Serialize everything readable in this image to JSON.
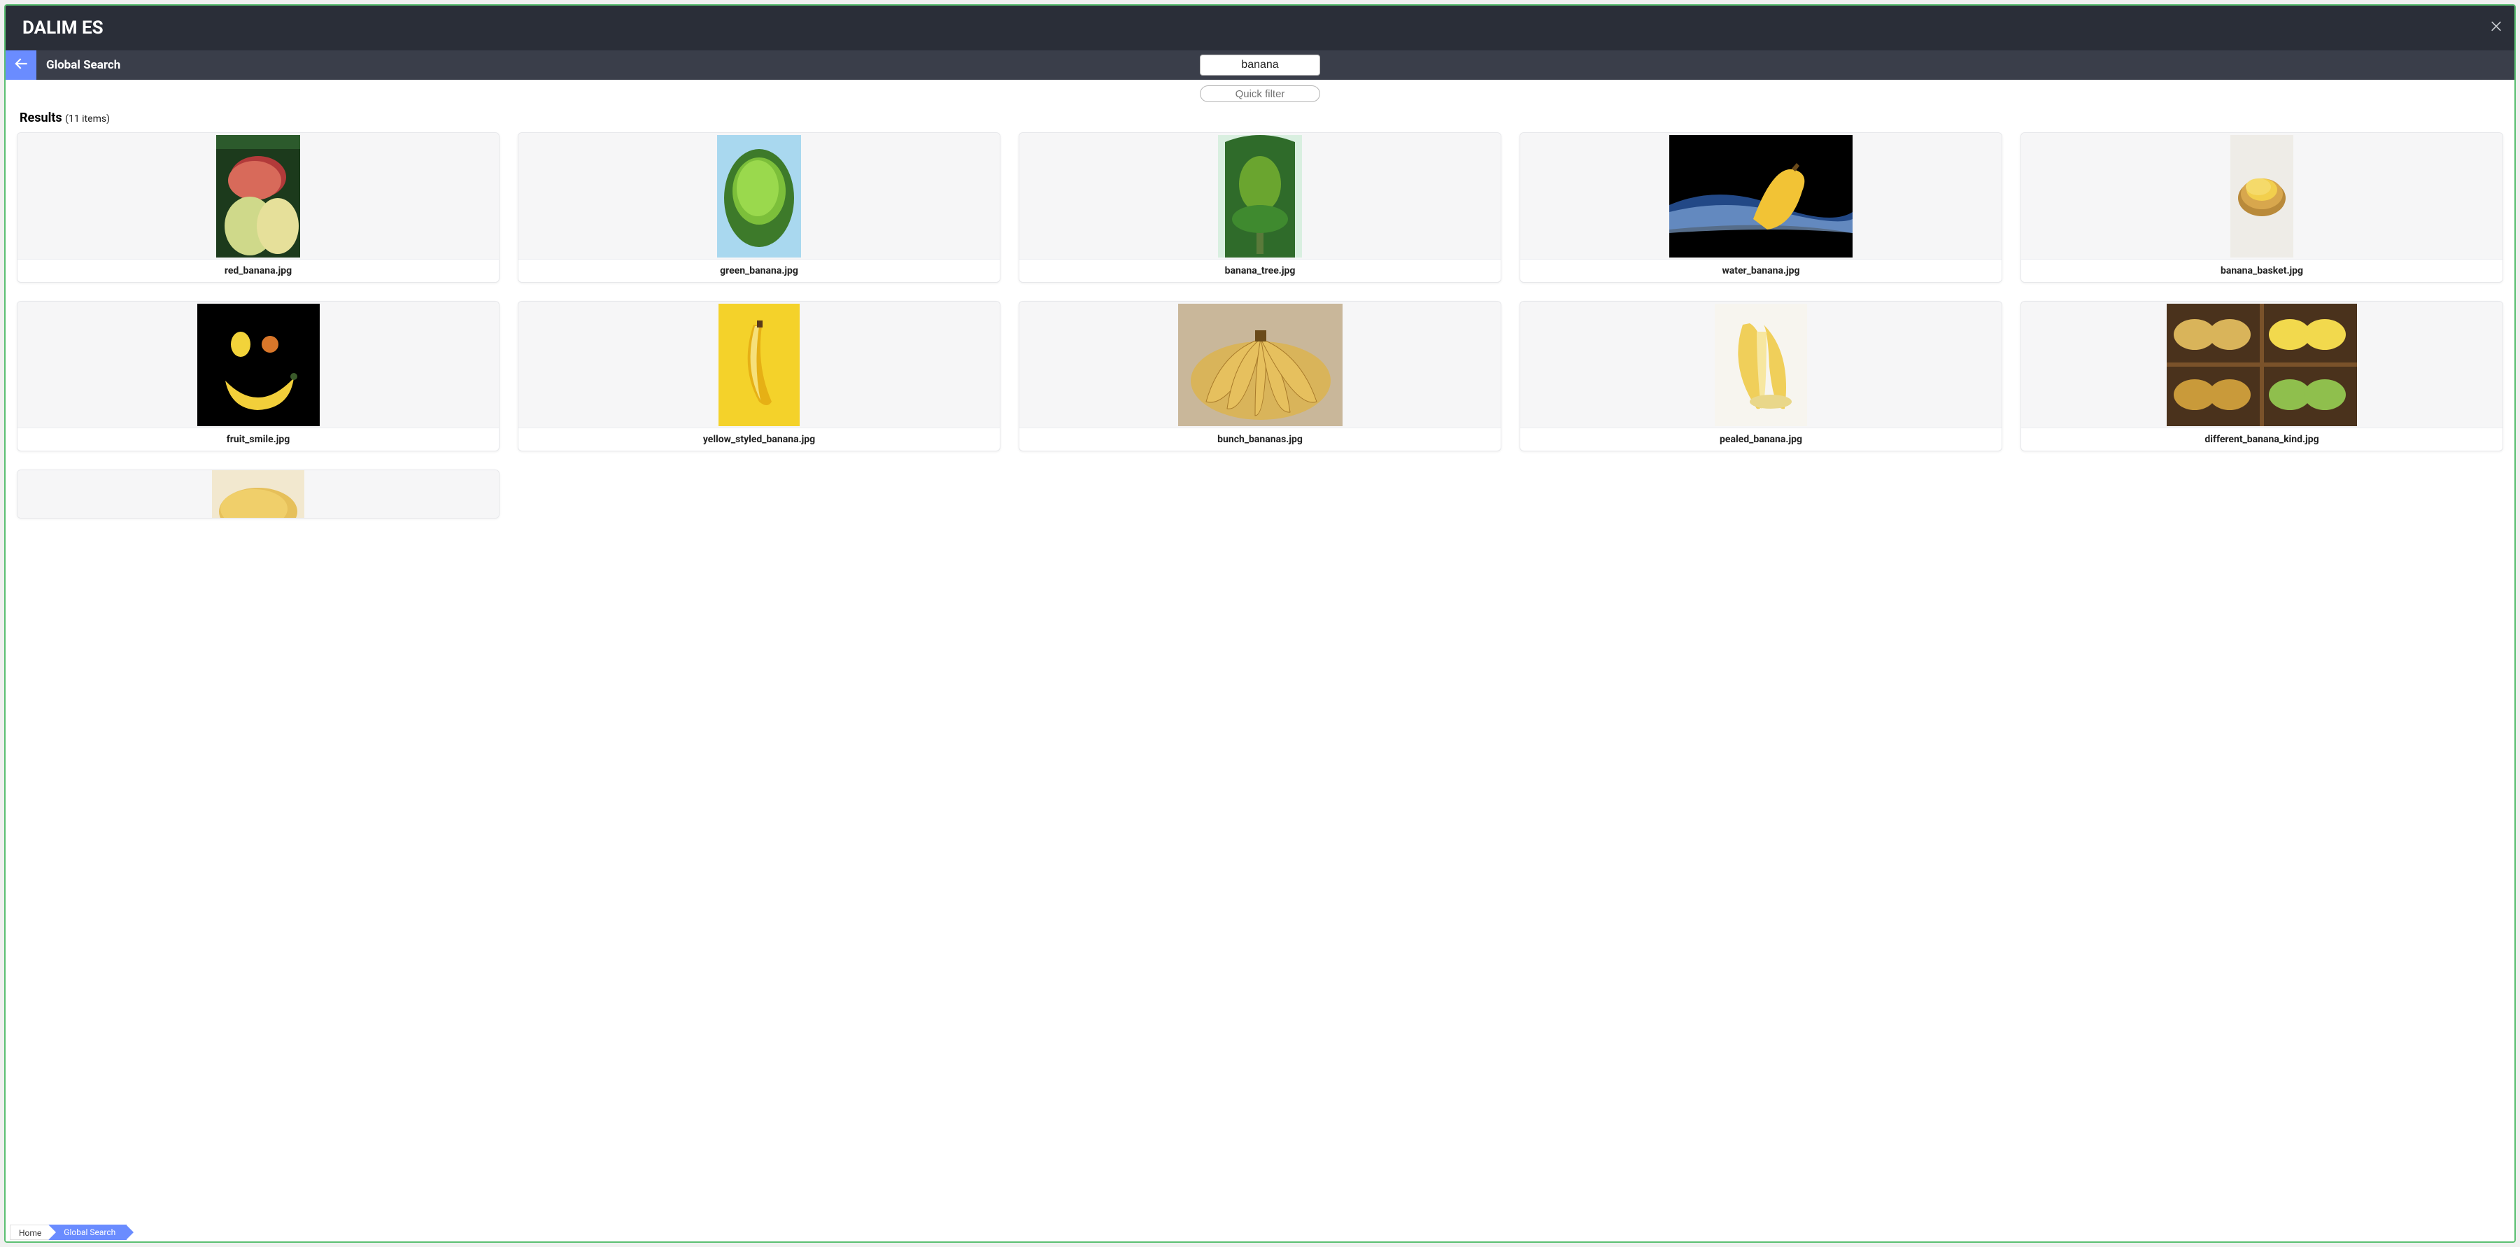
{
  "app": {
    "title": "DALIM ES"
  },
  "searchbar": {
    "title": "Global Search",
    "query": "banana"
  },
  "quickfilter": {
    "placeholder": "Quick filter"
  },
  "results": {
    "label": "Results",
    "count_text": "(11 items)"
  },
  "items": [
    {
      "name": "red_banana.jpg"
    },
    {
      "name": "green_banana.jpg"
    },
    {
      "name": "banana_tree.jpg"
    },
    {
      "name": "water_banana.jpg"
    },
    {
      "name": "banana_basket.jpg"
    },
    {
      "name": "fruit_smile.jpg"
    },
    {
      "name": "yellow_styled_banana.jpg"
    },
    {
      "name": "bunch_bananas.jpg"
    },
    {
      "name": "pealed_banana.jpg"
    },
    {
      "name": "different_banana_kind.jpg"
    },
    {
      "name": ""
    }
  ],
  "breadcrumb": {
    "home": "Home",
    "current": "Global Search"
  }
}
